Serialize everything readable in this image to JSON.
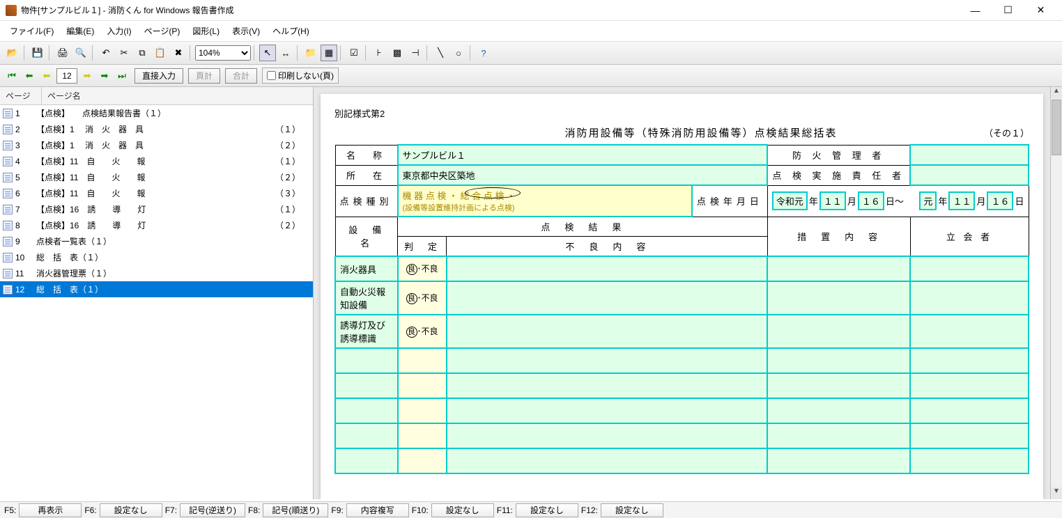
{
  "window": {
    "title": "物件[サンプルビル１] - 消防くん for Windows 報告書作成",
    "min": "—",
    "max": "☐",
    "close": "✕"
  },
  "menu": [
    "ファイル(F)",
    "編集(E)",
    "入力(I)",
    "ページ(P)",
    "図形(L)",
    "表示(V)",
    "ヘルプ(H)"
  ],
  "zoom": "104%",
  "nav": {
    "page": "12",
    "direct": "直接入力",
    "page_sum": "頁計",
    "total": "合計",
    "noprint": "印刷しない(頁)"
  },
  "sidebar": {
    "head": {
      "c1": "ページ",
      "c2": "ページ名"
    },
    "rows": [
      {
        "num": "1",
        "name": "【点検】　　点検結果報告書（１）",
        "p": ""
      },
      {
        "num": "2",
        "name": "【点検】1　 消　火　器　具",
        "p": "（１）"
      },
      {
        "num": "3",
        "name": "【点検】1　 消　火　器　具",
        "p": "（２）"
      },
      {
        "num": "4",
        "name": "【点検】11　自　　火　　報",
        "p": "（１）"
      },
      {
        "num": "5",
        "name": "【点検】11　自　　火　　報",
        "p": "（２）"
      },
      {
        "num": "6",
        "name": "【点検】11　自　　火　　報",
        "p": "（３）"
      },
      {
        "num": "7",
        "name": "【点検】16　誘　　導　　灯",
        "p": "（１）"
      },
      {
        "num": "8",
        "name": "【点検】16　誘　　導　　灯",
        "p": "（２）"
      },
      {
        "num": "9",
        "name": "点検者一覧表（１）",
        "p": ""
      },
      {
        "num": "10",
        "name": "総　括　表（１）",
        "p": ""
      },
      {
        "num": "11",
        "name": "消火器管理票（１）",
        "p": ""
      },
      {
        "num": "12",
        "name": "総　括　表（１）",
        "p": "",
        "selected": true
      }
    ]
  },
  "doc": {
    "form_label": "別記様式第2",
    "title": "消防用設備等（特殊消防用設備等）点検結果総括表",
    "pageno": "（その１）",
    "name_lbl": "名　称",
    "name_val": "サンプルビル１",
    "mgr_lbl": "防 火 管 理 者",
    "mgr_val": "",
    "loc_lbl": "所　在",
    "loc_val": "東京都中央区築地",
    "resp_lbl": "点 検 実 施 責 任 者",
    "resp_val": "",
    "type_lbl": "点検種別",
    "type_line1": "機 器 点 検 ・ 総 合 点 検 ・",
    "type_line2": "(設備等設置維持計画による点検)",
    "date_lbl": "点検年月日",
    "date_from": {
      "era": "令和元",
      "y": "年",
      "m1": "１１",
      "mu": "月",
      "d1": "１６",
      "du": "日～"
    },
    "date_to": {
      "era": "元",
      "y": "年",
      "m1": "１１",
      "mu": "月",
      "d1": "１６",
      "du": "日"
    },
    "cols": {
      "equip": "設　備　名",
      "kekka": "点　検　結　果",
      "hantei": "判　定",
      "furyo": "不　良　内　容",
      "sochi": "措　置　内　容",
      "tachi": "立 会 者"
    },
    "judge_good": "良",
    "judge_bad": "不良",
    "rows": [
      {
        "name": "消火器具",
        "judge": true
      },
      {
        "name": "自動火災報知設備",
        "judge": true
      },
      {
        "name": "誘導灯及び誘導標識",
        "judge": true
      },
      {
        "name": "",
        "judge": false
      },
      {
        "name": "",
        "judge": false
      },
      {
        "name": "",
        "judge": false
      },
      {
        "name": "",
        "judge": false
      },
      {
        "name": "",
        "judge": false
      }
    ]
  },
  "fn": {
    "f5": {
      "l": "F5:",
      "b": "再表示"
    },
    "f6": {
      "l": "F6:",
      "b": "設定なし"
    },
    "f7": {
      "l": "F7:",
      "b": "記号(逆送り)"
    },
    "f8": {
      "l": "F8:",
      "b": "記号(順送り)"
    },
    "f9": {
      "l": "F9:",
      "b": "内容複写"
    },
    "f10": {
      "l": "F10:",
      "b": "設定なし"
    },
    "f11": {
      "l": "F11:",
      "b": "設定なし"
    },
    "f12": {
      "l": "F12:",
      "b": "設定なし"
    }
  }
}
